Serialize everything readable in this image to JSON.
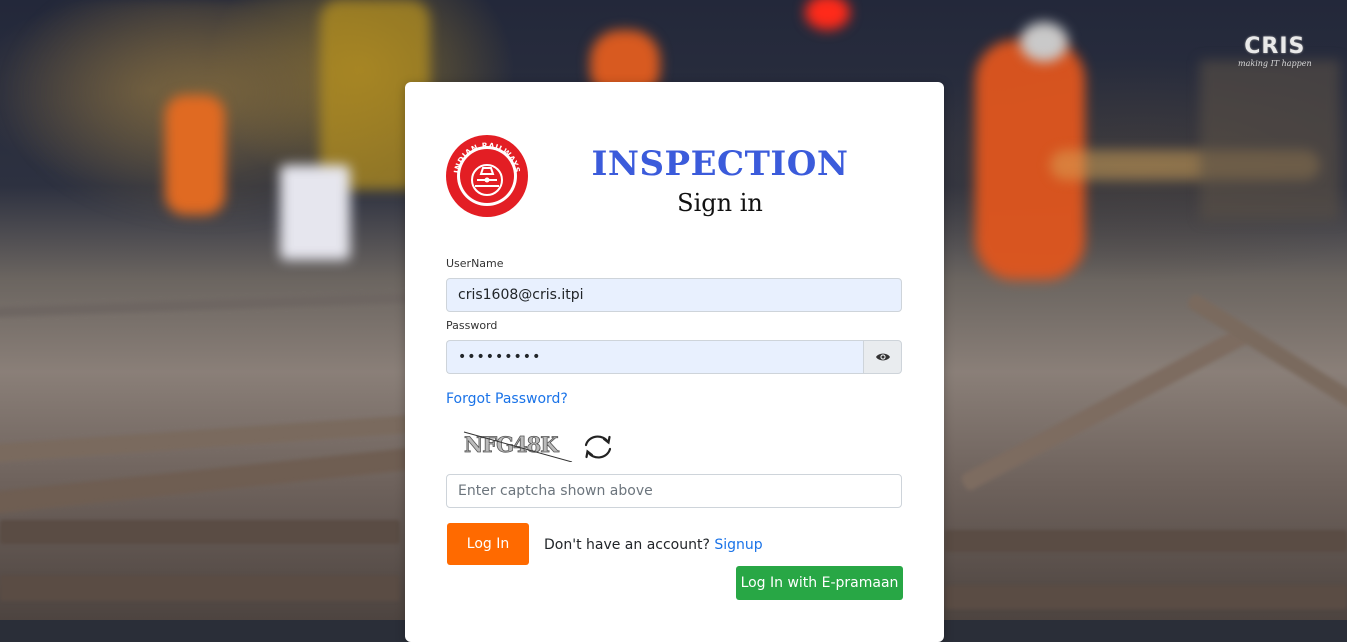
{
  "brand": {
    "title": "INSPECTION",
    "subtitle": "Sign in",
    "corner_logo": {
      "word": "CRIS",
      "tagline": "making IT happen"
    },
    "emblem": {
      "text": "INDIAN RAILWAYS",
      "color": "#e31e24"
    }
  },
  "form": {
    "username_label": "UserName",
    "username_value": "cris1608@cris.itpi",
    "password_label": "Password",
    "password_value": "•••••••••",
    "show_password_icon": "eye-icon",
    "forgot_password": "Forgot Password?",
    "captcha_text": "NFG48K",
    "refresh_icon": "refresh-icon",
    "captcha_placeholder": "Enter captcha shown above",
    "login_button": "Log In",
    "no_account_text": "Don't have an account?",
    "signup_link": "Signup",
    "epramaan_button": "Log In with E-pramaan"
  },
  "colors": {
    "title": "#3b5bdb",
    "login": "#ff6a00",
    "epramaan": "#28a745",
    "link": "#1a73e8",
    "autofill": "#e8f0fe"
  }
}
